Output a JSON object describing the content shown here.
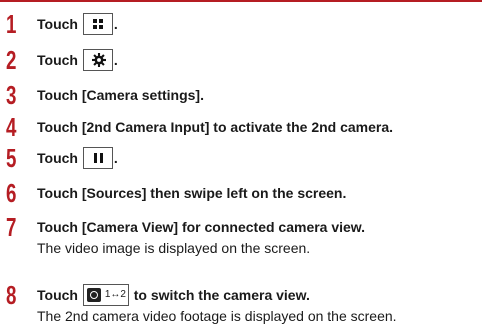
{
  "steps": [
    {
      "num": "1",
      "text": "Touch",
      "icon": "menu-grid-icon",
      "after": "."
    },
    {
      "num": "2",
      "text": "Touch",
      "icon": "gear-icon",
      "after": "."
    },
    {
      "num": "3",
      "text": "Touch [Camera settings]."
    },
    {
      "num": "4",
      "text": "Touch [2nd Camera Input]  to activate the 2nd camera."
    },
    {
      "num": "5",
      "text": "Touch",
      "icon": "pause-icon",
      "after": "."
    },
    {
      "num": "6",
      "text": "Touch [Sources] then swipe left on the screen."
    },
    {
      "num": "7",
      "text": "Touch [Camera View] for connected camera view.",
      "sub": "The video image is displayed on the screen."
    },
    {
      "num": "8",
      "text": "Touch",
      "icon": "camera-switch-icon",
      "icon_text": "1↔2",
      "after": " to switch the camera view.",
      "sub": "The 2nd camera video footage is displayed on the screen."
    }
  ]
}
